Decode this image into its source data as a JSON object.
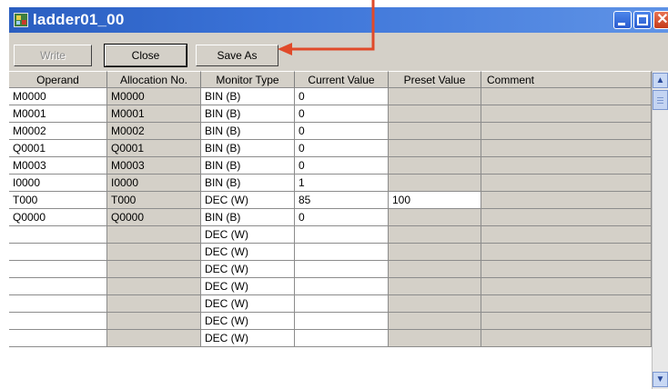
{
  "window": {
    "title": "ladder01_00"
  },
  "icons": {
    "app": "ladder-app-icon",
    "minimize": "minimize-icon",
    "maximize": "maximize-icon",
    "close": "close-icon"
  },
  "toolbar": {
    "write_label": "Write",
    "close_label": "Close",
    "save_as_label": "Save As"
  },
  "annotation": {
    "color": "#e04a2a"
  },
  "table": {
    "columns": [
      "Operand",
      "Allocation No.",
      "Monitor Type",
      "Current Value",
      "Preset Value",
      "Comment"
    ],
    "rows": [
      [
        "M0000",
        "M0000",
        "BIN (B)",
        "0",
        "",
        ""
      ],
      [
        "M0001",
        "M0001",
        "BIN (B)",
        "0",
        "",
        ""
      ],
      [
        "M0002",
        "M0002",
        "BIN (B)",
        "0",
        "",
        ""
      ],
      [
        "Q0001",
        "Q0001",
        "BIN (B)",
        "0",
        "",
        ""
      ],
      [
        "M0003",
        "M0003",
        "BIN (B)",
        "0",
        "",
        ""
      ],
      [
        "I0000",
        "I0000",
        "BIN (B)",
        "1",
        "",
        ""
      ],
      [
        "T000",
        "T000",
        "DEC (W)",
        "85",
        "100",
        ""
      ],
      [
        "Q0000",
        "Q0000",
        "BIN (B)",
        "0",
        "",
        ""
      ],
      [
        "",
        "",
        "DEC (W)",
        "",
        "",
        ""
      ],
      [
        "",
        "",
        "DEC (W)",
        "",
        "",
        ""
      ],
      [
        "",
        "",
        "DEC (W)",
        "",
        "",
        ""
      ],
      [
        "",
        "",
        "DEC (W)",
        "",
        "",
        ""
      ],
      [
        "",
        "",
        "DEC (W)",
        "",
        "",
        ""
      ],
      [
        "",
        "",
        "DEC (W)",
        "",
        "",
        ""
      ],
      [
        "",
        "",
        "DEC (W)",
        "",
        "",
        ""
      ]
    ]
  }
}
